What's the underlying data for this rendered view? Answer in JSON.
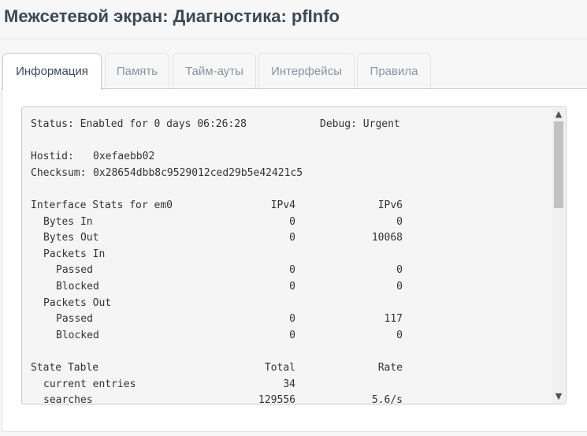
{
  "page": {
    "title": "Межсетевой экран: Диагностика: pfInfo"
  },
  "tabs": [
    {
      "label": "Информация",
      "active": true
    },
    {
      "label": "Память",
      "active": false
    },
    {
      "label": "Тайм-ауты",
      "active": false
    },
    {
      "label": "Интерфейсы",
      "active": false
    },
    {
      "label": "Правила",
      "active": false
    }
  ],
  "info": {
    "status_label": "Status: Enabled for 0 days 06:26:28",
    "debug_label": "Debug: Urgent",
    "hostid_label": "Hostid:",
    "hostid_value": "0xefaebb02",
    "checksum_label": "Checksum:",
    "checksum_value": "0x28654dbb8c9529012ced29b5e42421c5",
    "iface_stats": {
      "header": "Interface Stats for em0",
      "col_ipv4": "IPv4",
      "col_ipv6": "IPv6",
      "bytes_in": {
        "label": "Bytes In",
        "ipv4": "0",
        "ipv6": "0"
      },
      "bytes_out": {
        "label": "Bytes Out",
        "ipv4": "0",
        "ipv6": "10068"
      },
      "packets_in": {
        "label": "Packets In"
      },
      "packets_in_passed": {
        "label": "Passed",
        "ipv4": "0",
        "ipv6": "0"
      },
      "packets_in_blocked": {
        "label": "Blocked",
        "ipv4": "0",
        "ipv6": "0"
      },
      "packets_out": {
        "label": "Packets Out"
      },
      "packets_out_passed": {
        "label": "Passed",
        "ipv4": "0",
        "ipv6": "117"
      },
      "packets_out_blocked": {
        "label": "Blocked",
        "ipv4": "0",
        "ipv6": "0"
      }
    },
    "state_table": {
      "header": "State Table",
      "col_total": "Total",
      "col_rate": "Rate",
      "current_entries": {
        "label": "current entries",
        "total": "34",
        "rate": ""
      },
      "searches": {
        "label": "searches",
        "total": "129556",
        "rate": "5.6/s"
      }
    }
  },
  "scrollbar": {
    "up_icon": "▲",
    "down_icon": "▼"
  }
}
